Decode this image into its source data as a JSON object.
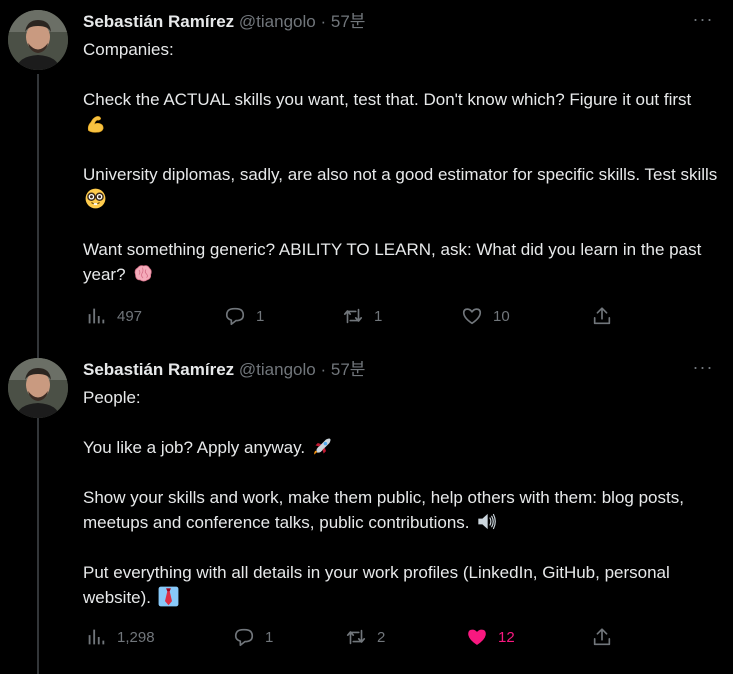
{
  "tweets": [
    {
      "author": {
        "name": "Sebastián Ramírez",
        "handle": "@tiangolo"
      },
      "separator": "·",
      "time": "57분",
      "more_label": "···",
      "paragraphs": [
        "Companies:",
        "Check the ACTUAL skills you want, test that. Don't know which? Figure it out first",
        "University diplomas, sadly, are also not a good estimator for specific skills. Test skills",
        "Want something generic? ABILITY TO LEARN, ask: What did you learn in the past year?"
      ],
      "paragraph_emojis": [
        "",
        "flexed-biceps-emoji",
        "nerd-face-emoji",
        "brain-emoji"
      ],
      "stats": {
        "views": "497",
        "replies": "1",
        "retweets": "1",
        "likes": "10"
      },
      "liked": false
    },
    {
      "author": {
        "name": "Sebastián Ramírez",
        "handle": "@tiangolo"
      },
      "separator": "·",
      "time": "57분",
      "more_label": "···",
      "paragraphs": [
        "People:",
        "You like a job? Apply anyway.",
        "Show your skills and work, make them public, help others with them: blog posts, meetups and conference talks, public contributions.",
        "Put everything with all details in your work profiles (LinkedIn, GitHub, personal website)."
      ],
      "paragraph_emojis": [
        "",
        "rocket-emoji",
        "loudspeaker-emoji",
        "necktie-emoji"
      ],
      "stats": {
        "views": "1,298",
        "replies": "1",
        "retweets": "2",
        "likes": "12"
      },
      "liked": true
    }
  ],
  "colors": {
    "background": "#000000",
    "text": "#e7e9ea",
    "muted": "#71767b",
    "like_active": "#f91880",
    "thread_line": "#333639"
  }
}
